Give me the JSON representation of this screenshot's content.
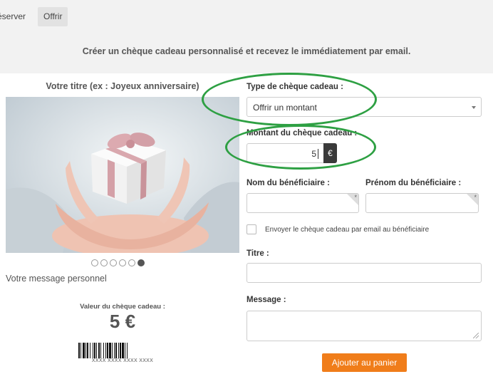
{
  "nav": {
    "tabs": [
      {
        "label": "éserver"
      },
      {
        "label": "Offrir"
      }
    ]
  },
  "header": {
    "headline": "Créer un chèque cadeau personnalisé et recevez le immédiatement par email."
  },
  "preview": {
    "title_placeholder": "Votre titre (ex : Joyeux anniversaire)",
    "image_alt": "gift box held in hands",
    "carousel": {
      "total": 6,
      "active_index": 5
    },
    "message_placeholder": "Votre message personnel",
    "value_label": "Valeur du chèque cadeau :",
    "value_amount": "5 €",
    "barcode_text": "XXXX XXXX XXXX XXXX"
  },
  "form": {
    "type_label": "Type de chèque cadeau :",
    "type_value": "Offrir un montant",
    "amount_label": "Montant du chèque cadeau :",
    "amount_value": "5",
    "currency": "€",
    "lastname_label": "Nom du bénéficiaire :",
    "firstname_label": "Prénom du bénéficiaire :",
    "send_email_label": "Envoyer le chèque cadeau par email au bénéficiaire",
    "send_email_checked": false,
    "title_label": "Titre :",
    "message_label": "Message :",
    "add_to_cart_label": "Ajouter au panier"
  },
  "colors": {
    "accent_orange": "#f07d1a",
    "highlight_green": "#2ea043",
    "euro_bg": "#3a3a3a"
  }
}
